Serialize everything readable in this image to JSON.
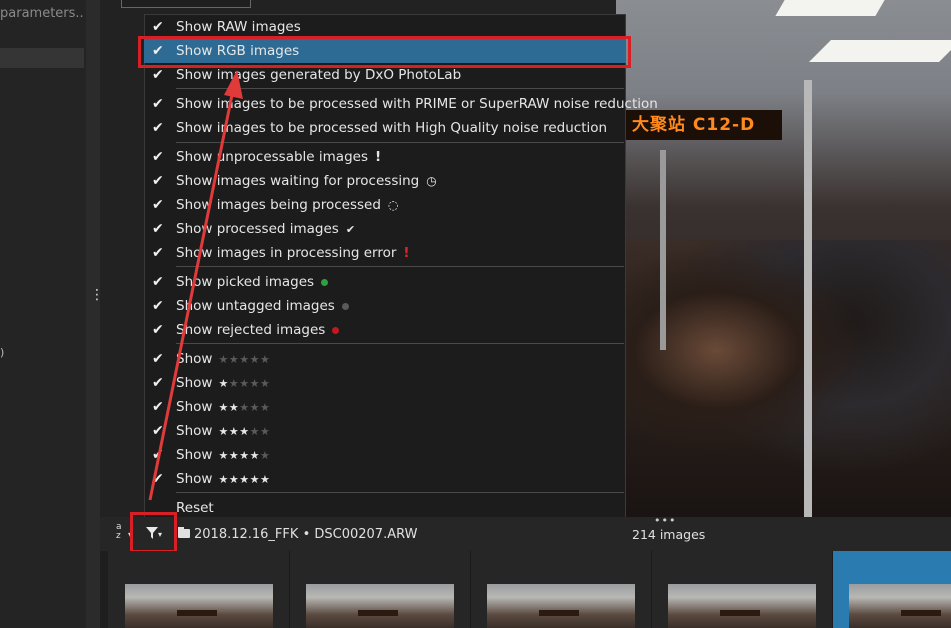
{
  "left_panel": {
    "search_placeholder": "parameters..."
  },
  "filter_menu": {
    "items": [
      {
        "label": "Show RAW images",
        "checked": true
      },
      {
        "label": "Show RGB images",
        "checked": true,
        "selected": true
      },
      {
        "label": "Show images generated by DxO PhotoLab",
        "checked": true
      },
      {
        "label": "Show images to be processed with PRIME or SuperRAW noise reduction",
        "checked": true
      },
      {
        "label": "Show images to be processed with High Quality noise reduction",
        "checked": true
      },
      {
        "label": "Show unprocessable images",
        "checked": true,
        "icon": "exclamation-icon"
      },
      {
        "label": "Show images waiting for processing",
        "checked": true,
        "icon": "clock-icon"
      },
      {
        "label": "Show images being processed",
        "checked": true,
        "icon": "spinner-icon"
      },
      {
        "label": "Show processed images",
        "checked": true,
        "icon": "checkmark-icon"
      },
      {
        "label": "Show images in processing error",
        "checked": true,
        "icon": "error-exclamation-icon"
      },
      {
        "label": "Show picked images",
        "checked": true,
        "icon": "dot-icon",
        "dot_color": "#2ea043"
      },
      {
        "label": "Show untagged images",
        "checked": true,
        "icon": "dot-icon",
        "dot_color": "#5a5a5a"
      },
      {
        "label": "Show rejected images",
        "checked": true,
        "icon": "dot-icon",
        "dot_color": "#c8161d"
      },
      {
        "label": "Show",
        "checked": true,
        "stars": 0
      },
      {
        "label": "Show",
        "checked": true,
        "stars": 1
      },
      {
        "label": "Show",
        "checked": true,
        "stars": 2
      },
      {
        "label": "Show",
        "checked": true,
        "stars": 3
      },
      {
        "label": "Show",
        "checked": true,
        "stars": 4
      },
      {
        "label": "Show",
        "checked": true,
        "stars": 5
      },
      {
        "label": "Reset",
        "checked": false
      }
    ]
  },
  "toolbar": {
    "sort_label": "a z",
    "breadcrumb_folder": "2018.12.16_FFK",
    "breadcrumb_sep": "•",
    "breadcrumb_file": "DSC00207.ARW",
    "image_count": "214 images"
  },
  "viewer": {
    "sign_text": "大聚站 C12-D"
  },
  "colors": {
    "accent_highlight": "#d81f26",
    "selection": "#2d6b94",
    "selected_thumb": "#2a7bb0"
  }
}
